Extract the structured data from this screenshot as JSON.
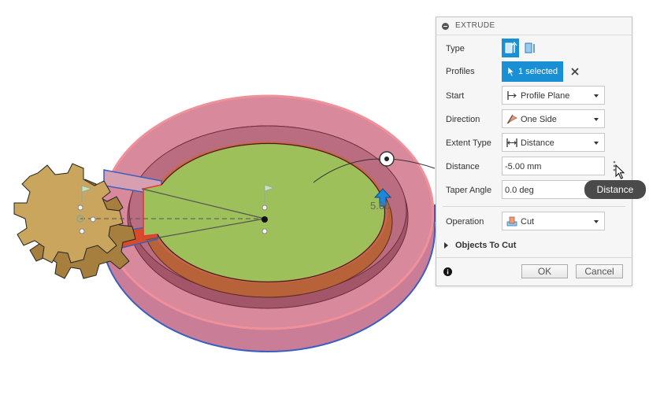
{
  "dialog": {
    "title": "EXTRUDE",
    "type_label": "Type",
    "profiles_label": "Profiles",
    "profiles_value": "1 selected",
    "start_label": "Start",
    "start_value": "Profile Plane",
    "direction_label": "Direction",
    "direction_value": "One Side",
    "extent_label": "Extent Type",
    "extent_value": "Distance",
    "distance_label": "Distance",
    "distance_value": "-5.00 mm",
    "taper_label": "Taper Angle",
    "taper_value": "0.0 deg",
    "operation_label": "Operation",
    "operation_value": "Cut",
    "objects_to_cut": "Objects To Cut",
    "ok_label": "OK",
    "cancel_label": "Cancel"
  },
  "tooltip": "Distance",
  "viewport": {
    "dimension_label": "5.00"
  },
  "colors": {
    "accent": "#1b8fd3",
    "face_green": "#9dc05a",
    "wall_pink": "#d08aa0",
    "gear": "#c9a55d"
  },
  "icons": [
    "collapse-icon",
    "extrude-solid-icon",
    "extrude-thin-icon",
    "cursor-select-icon",
    "clear-x-icon",
    "profile-plane-icon",
    "one-side-flag-icon",
    "distance-arrows-icon",
    "kebab-menu-icon",
    "mouse-pointer-icon",
    "cut-operation-icon",
    "expand-triangle-icon",
    "info-icon"
  ]
}
